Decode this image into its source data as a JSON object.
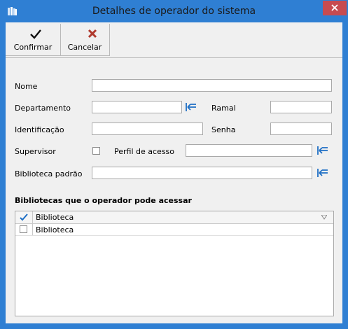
{
  "window": {
    "title": "Detalhes de operador do sistema"
  },
  "toolbar": {
    "confirm_label": "Confirmar",
    "cancel_label": "Cancelar"
  },
  "form": {
    "nome_label": "Nome",
    "departamento_label": "Departamento",
    "ramal_label": "Ramal",
    "identificacao_label": "Identificação",
    "senha_label": "Senha",
    "supervisor_label": "Supervisor",
    "perfil_label": "Perfil de acesso",
    "biblioteca_label": "Biblioteca padrão"
  },
  "libraries": {
    "section_title": "Bibliotecas que o operador pode acessar",
    "header": "Biblioteca",
    "rows": [
      {
        "name": "Biblioteca",
        "checked": false
      }
    ]
  },
  "colors": {
    "titlebar": "#2f7fd3",
    "close": "#c74b50",
    "accent": "#1f6fc5",
    "cancel_x": "#b03a2e"
  }
}
